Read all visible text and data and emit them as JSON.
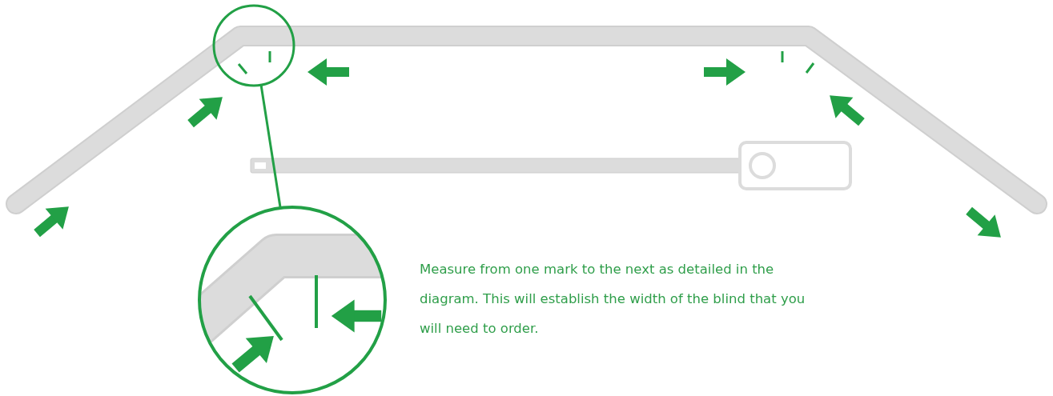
{
  "instruction": "Measure from one mark to the next as detailed in the diagram. This will establish the width of the blind that you will need to order."
}
